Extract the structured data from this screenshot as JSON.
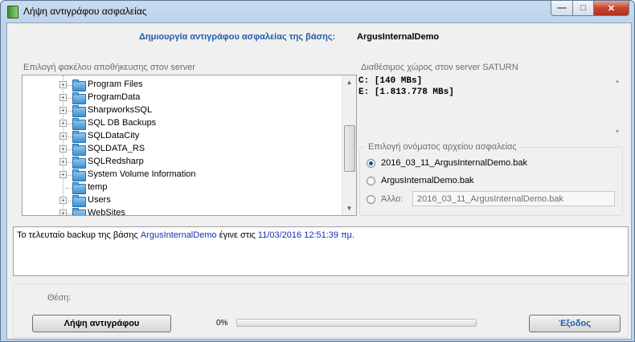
{
  "window": {
    "title": "Λήψη αντιγράφου ασφαλείας"
  },
  "header": {
    "label": "Δημιουργία αντιγράφου ασφαλείας της βάσης:",
    "database": "ArgusInternalDemo"
  },
  "folder_panel": {
    "label": "Επιλογή φακέλου αποθήκευσης στον server",
    "items": [
      {
        "label": "Program Files",
        "expandable": true
      },
      {
        "label": "ProgramData",
        "expandable": true
      },
      {
        "label": "SharpworksSQL",
        "expandable": true
      },
      {
        "label": "SQL DB Backups",
        "expandable": true
      },
      {
        "label": "SQLDataCity",
        "expandable": true
      },
      {
        "label": "SQLDATA_RS",
        "expandable": true
      },
      {
        "label": "SQLRedsharp",
        "expandable": true
      },
      {
        "label": "System Volume Information",
        "expandable": true
      },
      {
        "label": "temp",
        "expandable": false
      },
      {
        "label": "Users",
        "expandable": true
      },
      {
        "label": "WebSites",
        "expandable": true
      }
    ]
  },
  "space_panel": {
    "label": "Διαθέσιμος χώρος στον server SATURN",
    "drives": [
      {
        "text": "C:  [140 MBs]"
      },
      {
        "text": "E:  [1.813.778 MBs]"
      }
    ]
  },
  "filename_group": {
    "label": "Επιλογή ονόματος αρχείου ασφαλείας",
    "options": [
      {
        "label": "2016_03_11_ArgusInternalDemo.bak",
        "checked": true
      },
      {
        "label": "ArgusInternalDemo.bak",
        "checked": false
      },
      {
        "label": "Άλλο:",
        "checked": false
      }
    ],
    "other_value": "2016_03_11_ArgusInternalDemo.bak"
  },
  "log": {
    "prefix": "Το τελευταίο backup της βάσης ",
    "database": "ArgusInternalDemo",
    "middle": " έγινε στις ",
    "datetime": "11/03/2016 12:51:39 πμ",
    "suffix": "."
  },
  "footer": {
    "position_label": "Θέση:",
    "backup_button": "Λήψη αντιγράφου",
    "progress_text": "0%",
    "progress_value": 0,
    "exit_button": "Έξοδος"
  },
  "colors": {
    "accent_blue": "#1f5fa8",
    "link_blue": "#1530b0",
    "progress_green": "#37b02a"
  }
}
